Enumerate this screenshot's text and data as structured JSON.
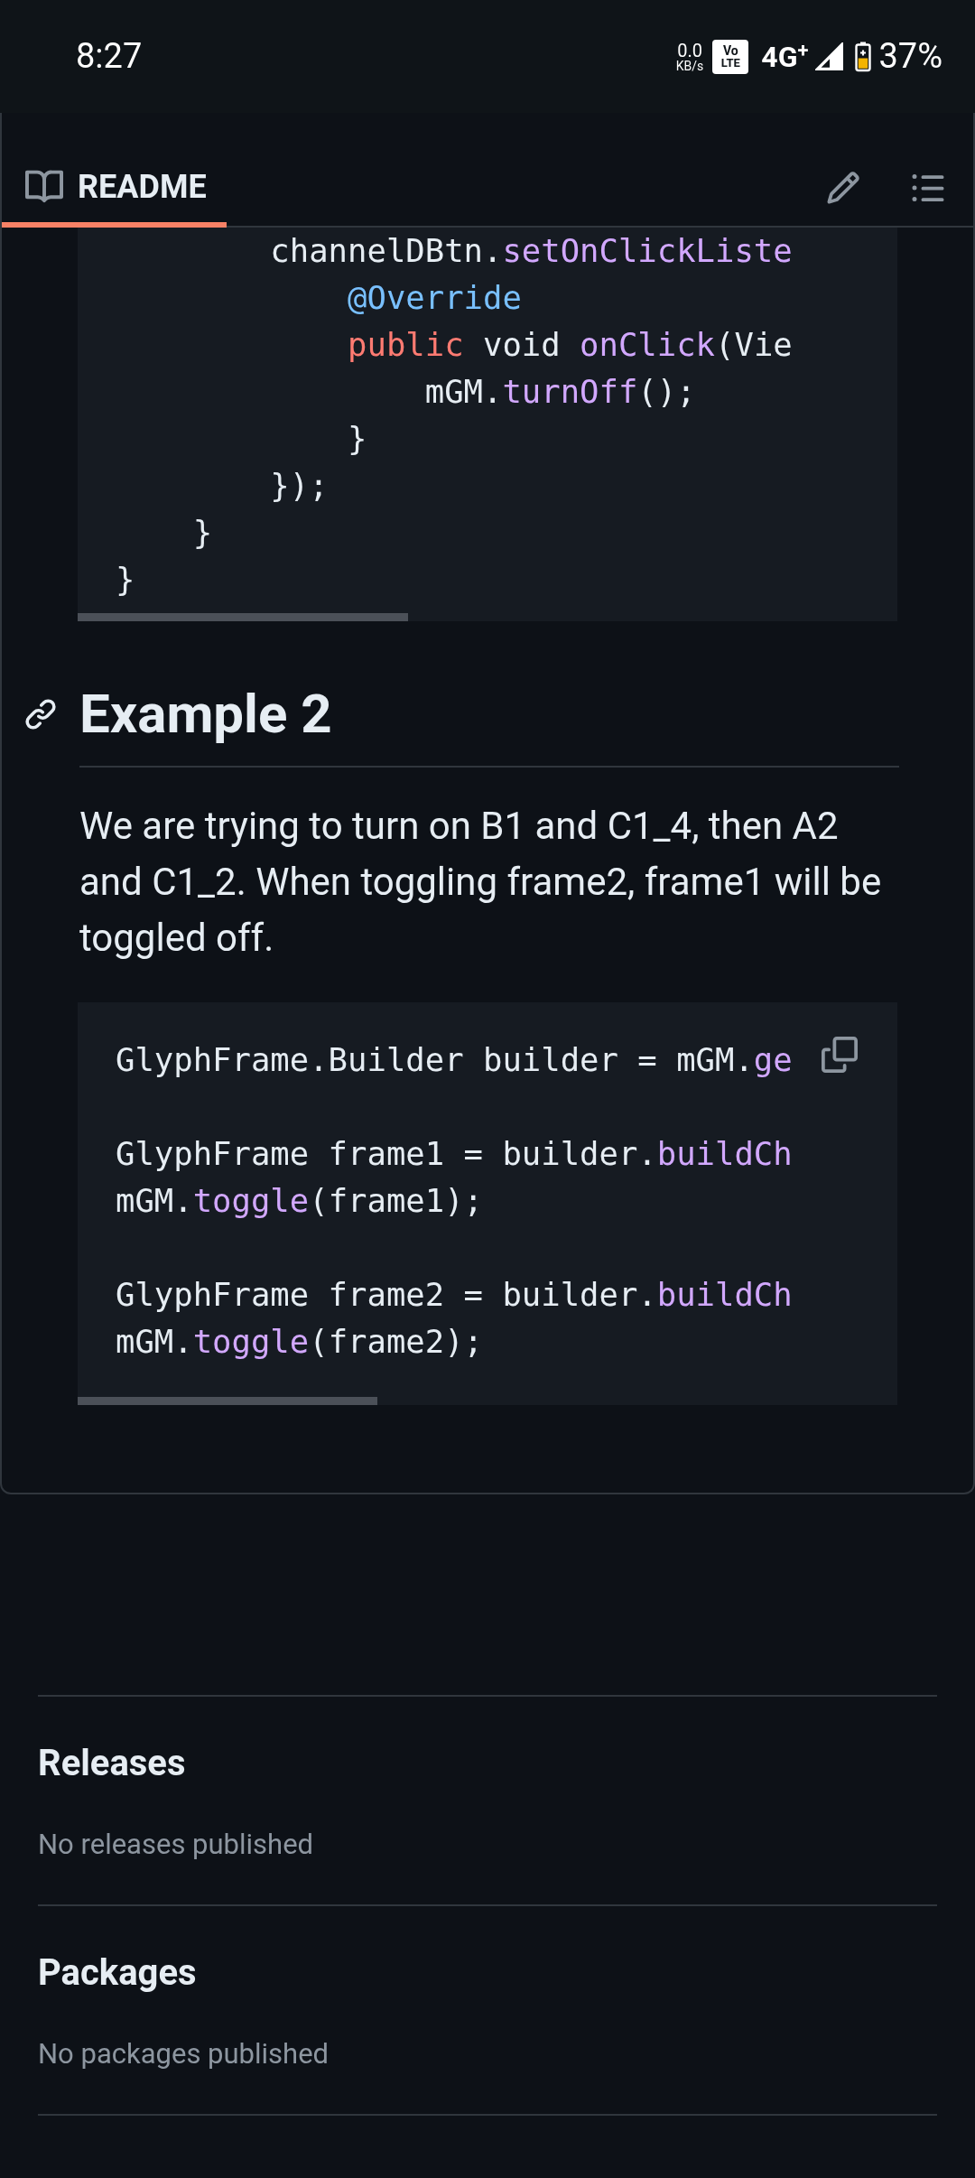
{
  "status_bar": {
    "time": "8:27",
    "net_speed": "0.0",
    "net_unit": "KB/s",
    "volte_top": "Vo",
    "volte_bottom": "LTE",
    "network": "4G",
    "network_plus": "+",
    "battery": "37%"
  },
  "header": {
    "tabs": [
      {
        "label": "README",
        "selected": true
      }
    ]
  },
  "code_block_1": {
    "lines": [
      {
        "kind": "code",
        "tokens": [
          {
            "t": "        channelDBtn.",
            "kind": "plain"
          },
          {
            "t": "setOnClickListe",
            "kind": "func"
          }
        ]
      },
      {
        "kind": "code",
        "tokens": [
          {
            "t": "            @Override",
            "kind": "annotation"
          }
        ]
      },
      {
        "kind": "code",
        "tokens": [
          {
            "t": "            public",
            "kind": "keyword"
          },
          {
            "t": " void ",
            "kind": "plain"
          },
          {
            "t": "onClick",
            "kind": "func"
          },
          {
            "t": "(Vie",
            "kind": "plain"
          }
        ]
      },
      {
        "kind": "code",
        "tokens": [
          {
            "t": "                mGM.",
            "kind": "plain"
          },
          {
            "t": "turnOff",
            "kind": "func"
          },
          {
            "t": "();",
            "kind": "plain"
          }
        ]
      },
      {
        "kind": "code",
        "tokens": [
          {
            "t": "            }",
            "kind": "plain"
          }
        ]
      },
      {
        "kind": "code",
        "tokens": [
          {
            "t": "        });",
            "kind": "plain"
          }
        ]
      },
      {
        "kind": "code",
        "tokens": [
          {
            "t": "    }",
            "kind": "plain"
          }
        ]
      },
      {
        "kind": "code",
        "tokens": [
          {
            "t": "}",
            "kind": "plain"
          }
        ]
      }
    ]
  },
  "section": {
    "heading": "Example 2",
    "paragraph": "We are trying to turn on B1 and C1_4, then A2 and C1_2. When toggling frame2, frame1 will be toggled off."
  },
  "code_block_2": {
    "lines": [
      {
        "kind": "code",
        "tokens": [
          {
            "t": "GlyphFrame.Builder builder = mGM.",
            "kind": "plain"
          },
          {
            "t": "ge",
            "kind": "func"
          }
        ]
      },
      {
        "kind": "blank"
      },
      {
        "kind": "code",
        "tokens": [
          {
            "t": "GlyphFrame frame1 = builder.",
            "kind": "plain"
          },
          {
            "t": "buildCh",
            "kind": "func"
          }
        ]
      },
      {
        "kind": "code",
        "tokens": [
          {
            "t": "mGM.",
            "kind": "plain"
          },
          {
            "t": "toggle",
            "kind": "func"
          },
          {
            "t": "(frame1);",
            "kind": "plain"
          }
        ]
      },
      {
        "kind": "blank"
      },
      {
        "kind": "code",
        "tokens": [
          {
            "t": "GlyphFrame frame2 = builder.",
            "kind": "plain"
          },
          {
            "t": "buildCh",
            "kind": "func"
          }
        ]
      },
      {
        "kind": "code",
        "tokens": [
          {
            "t": "mGM.",
            "kind": "plain"
          },
          {
            "t": "toggle",
            "kind": "func"
          },
          {
            "t": "(frame2);",
            "kind": "plain"
          }
        ]
      }
    ]
  },
  "sidebar_sections": [
    {
      "heading": "Releases",
      "text": "No releases published"
    },
    {
      "heading": "Packages",
      "text": "No packages published"
    }
  ]
}
